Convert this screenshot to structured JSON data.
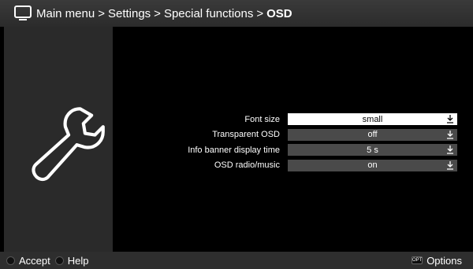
{
  "header": {
    "breadcrumb": [
      "Main menu",
      "Settings",
      "Special functions"
    ],
    "separator": ">",
    "current": "OSD",
    "icon": "tv-icon"
  },
  "settings": [
    {
      "label": "Font size",
      "value": "small",
      "selected": true
    },
    {
      "label": "Transparent OSD",
      "value": "off",
      "selected": false
    },
    {
      "label": "Info banner display time",
      "value": "5 s",
      "selected": false
    },
    {
      "label": "OSD radio/music",
      "value": "on",
      "selected": false
    }
  ],
  "footer": {
    "accept_label": "Accept",
    "help_label": "Help",
    "opt_badge": "OPT",
    "options_label": "Options"
  },
  "colors": {
    "title_bar": "#2f2f2f",
    "panel": "#2a2a2a",
    "field": "#4a4a4a",
    "field_selected": "#ffffff"
  }
}
